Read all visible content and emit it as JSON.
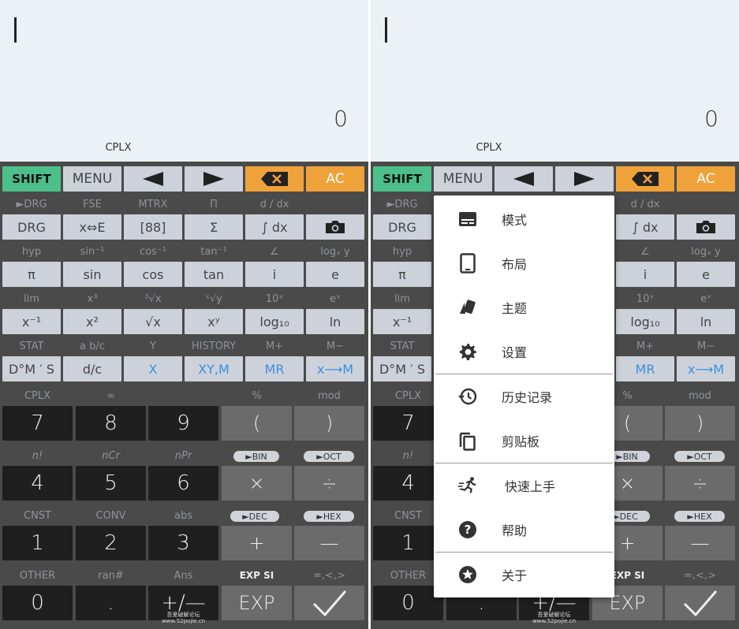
{
  "display": {
    "result": "0",
    "mode": "CPLX"
  },
  "top_row": {
    "shift": "SHIFT",
    "menu": "MENU",
    "left": "◀",
    "right": "▶",
    "delete": "✖",
    "ac": "AC"
  },
  "row1_labels": [
    "►DRG",
    "FSE",
    "MTRX",
    "Π",
    "d / dx",
    ""
  ],
  "row1_keys": [
    "DRG",
    "x⇔E",
    "[88]",
    "Σ",
    "∫ dx",
    "camera"
  ],
  "row2_labels": [
    "hyp",
    "sin⁻¹",
    "cos⁻¹",
    "tan⁻¹",
    "∠",
    "logₓ y"
  ],
  "row2_keys": [
    "π",
    "sin",
    "cos",
    "tan",
    "i",
    "e"
  ],
  "row3_labels": [
    "lim",
    "x³",
    "³√x",
    "ˣ√y",
    "10ˣ",
    "eˣ"
  ],
  "row3_keys": [
    "x⁻¹",
    "x²",
    "√x",
    "xʸ",
    "log₁₀",
    "ln"
  ],
  "row4_labels": [
    "STAT",
    "a b/c",
    "Y",
    "HISTORY",
    "M+",
    "M−"
  ],
  "row4_keys": [
    "D°M ′ S",
    "d/c",
    "X",
    "XY,M",
    "MR",
    "x⟶M"
  ],
  "row5_labels": [
    "CPLX",
    "∞",
    "",
    "%",
    "mod"
  ],
  "num_row1": [
    "7",
    "8",
    "9",
    "(",
    ")"
  ],
  "row6_labels": [
    "n!",
    "nCr",
    "nPr"
  ],
  "row6_pills": [
    "►BIN",
    "►OCT"
  ],
  "num_row2": [
    "4",
    "5",
    "6",
    "×",
    "÷"
  ],
  "row7_labels": [
    "CNST",
    "CONV",
    "abs"
  ],
  "row7_pills": [
    "►DEC",
    "►HEX"
  ],
  "num_row3": [
    "1",
    "2",
    "3",
    "+",
    "—"
  ],
  "row8_labels": [
    "OTHER",
    "ran#",
    "Ans",
    "EXP SI",
    "=,<,>"
  ],
  "num_row4": [
    "0",
    ".",
    "+/—",
    "EXP",
    "✓"
  ],
  "watermark": {
    "line1": "吾爱破解论坛",
    "line2": "www.52pojie.cn"
  },
  "menu": {
    "items": [
      {
        "label": "模式",
        "icon": "mode-icon"
      },
      {
        "label": "布局",
        "icon": "tablet-icon"
      },
      {
        "label": "主题",
        "icon": "theme-cards-icon"
      },
      {
        "label": "设置",
        "icon": "gear-icon"
      },
      {
        "label": "历史记录",
        "icon": "history-icon"
      },
      {
        "label": "剪贴板",
        "icon": "clipboard-icon"
      },
      {
        "label": "快速上手",
        "icon": "running-person-icon"
      },
      {
        "label": "帮助",
        "icon": "help-icon"
      },
      {
        "label": "关于",
        "icon": "star-badge-icon"
      }
    ]
  },
  "colors": {
    "shift": "#4dbf8a",
    "accent_orange": "#f0a23a",
    "memory_blue": "#3a8fe0",
    "display_bg": "#ecf1f5"
  }
}
